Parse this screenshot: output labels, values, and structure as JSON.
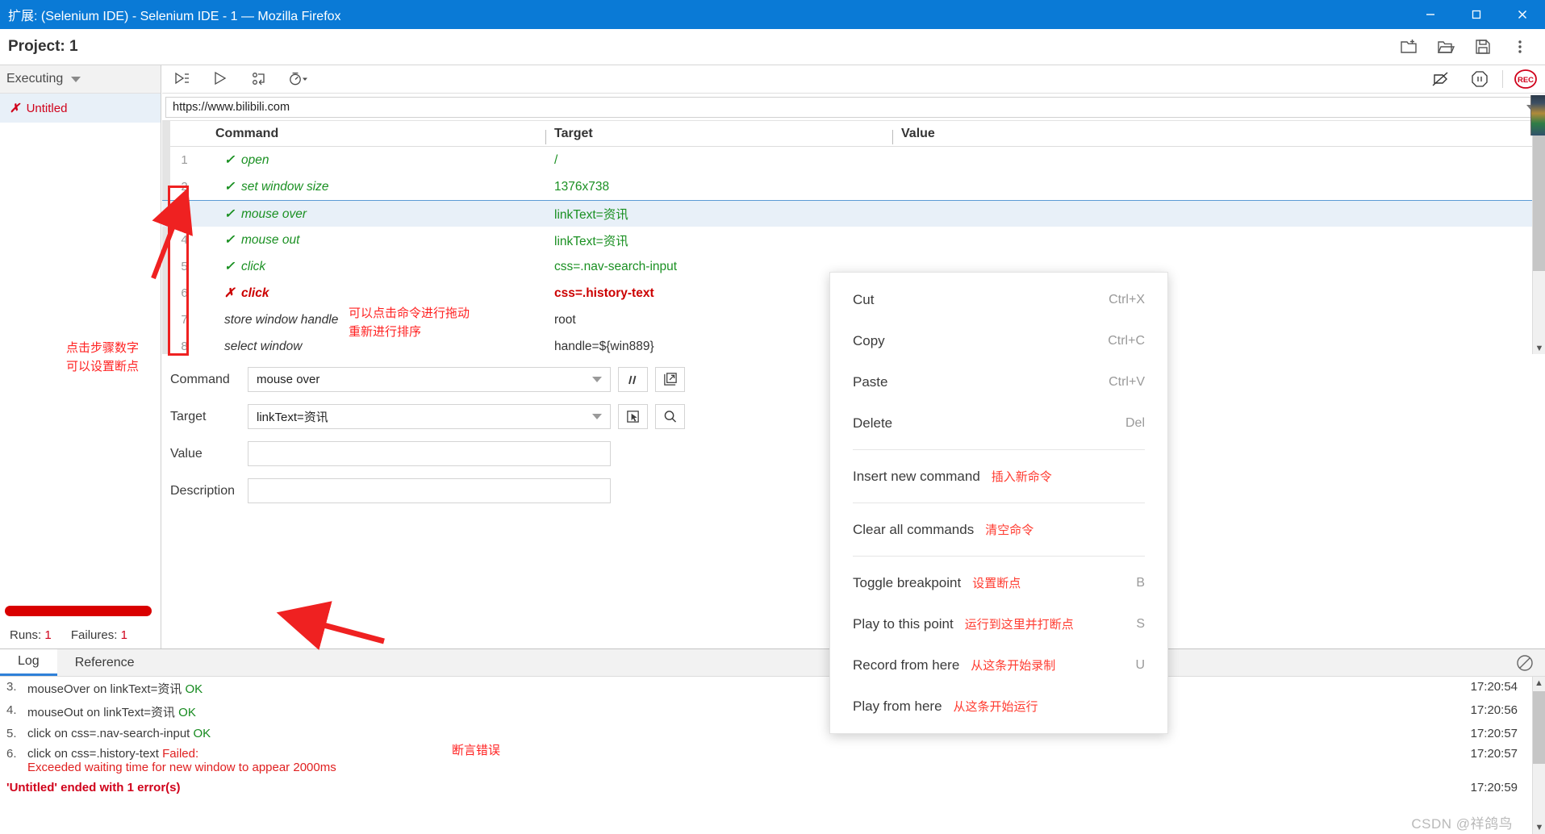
{
  "window": {
    "title": "扩展:  (Selenium IDE) - Selenium IDE - 1 — Mozilla Firefox",
    "minimize_label": "minimize",
    "maximize_label": "maximize",
    "close_label": "close"
  },
  "header": {
    "project_label": "Project:  1",
    "icons": [
      "new-project-icon",
      "open-project-icon",
      "save-project-icon",
      "more-options-icon"
    ]
  },
  "sidebar": {
    "mode_label": "Executing",
    "tests": [
      {
        "status": "✗",
        "name": "Untitled"
      }
    ],
    "annotation": [
      "点击步骤数字",
      "可以设置断点"
    ],
    "runs_label": "Runs:",
    "runs_value": "1",
    "failures_label": "Failures:",
    "failures_value": "1"
  },
  "run_toolbar": {
    "icons": [
      "play-all-tests-icon",
      "play-current-test-icon",
      "step-over-icon",
      "speed-control-icon"
    ],
    "right_icons": [
      "disable-breakpoints-icon",
      "pause-icon",
      "record-icon"
    ],
    "record_label": "REC"
  },
  "url_bar": {
    "value": "https://www.bilibili.com"
  },
  "table": {
    "columns": [
      "Command",
      "Target",
      "Value"
    ],
    "rows": [
      {
        "num": "1",
        "status": "✓",
        "status_kind": "ok",
        "command": "open",
        "target": "/",
        "value": ""
      },
      {
        "num": "2",
        "status": "✓",
        "status_kind": "ok",
        "command": "set window size",
        "target": "1376x738",
        "value": ""
      },
      {
        "num": "3",
        "status": "✓",
        "status_kind": "ok",
        "command": "mouse over",
        "target": "linkText=资讯",
        "value": ""
      },
      {
        "num": "4",
        "status": "✓",
        "status_kind": "ok",
        "command": "mouse out",
        "target": "linkText=资讯",
        "value": ""
      },
      {
        "num": "5",
        "status": "✓",
        "status_kind": "ok",
        "command": "click",
        "target": "css=.nav-search-input",
        "value": ""
      },
      {
        "num": "6",
        "status": "✗",
        "status_kind": "error",
        "command": "click",
        "target": "css=.history-text",
        "value": ""
      },
      {
        "num": "7",
        "status": "",
        "status_kind": "plain",
        "command": "store window handle",
        "target": "root",
        "value": ""
      },
      {
        "num": "8",
        "status": "",
        "status_kind": "plain",
        "command": "select window",
        "target": "handle=${win889}",
        "value": ""
      }
    ],
    "annotation": [
      "可以点击命令进行拖动",
      "重新进行排序"
    ]
  },
  "form": {
    "command_label": "Command",
    "command_value": "mouse over",
    "target_label": "Target",
    "target_value": "linkText=资讯",
    "value_label": "Value",
    "value_value": "",
    "description_label": "Description",
    "description_value": "",
    "buttons": [
      "comment-toggle-icon",
      "open-editor-icon",
      "select-target-icon",
      "find-target-icon"
    ]
  },
  "context_menu": {
    "items": [
      {
        "label": "Cut",
        "cn": "",
        "accel": "Ctrl+X"
      },
      {
        "label": "Copy",
        "cn": "",
        "accel": "Ctrl+C"
      },
      {
        "label": "Paste",
        "cn": "",
        "accel": "Ctrl+V"
      },
      {
        "label": "Delete",
        "cn": "",
        "accel": "Del"
      },
      {
        "sep": true
      },
      {
        "label": "Insert new command",
        "cn": "插入新命令",
        "accel": ""
      },
      {
        "sep": true
      },
      {
        "label": "Clear all commands",
        "cn": "清空命令",
        "accel": ""
      },
      {
        "sep": true
      },
      {
        "label": "Toggle breakpoint",
        "cn": "设置断点",
        "accel": "B"
      },
      {
        "label": "Play to this point",
        "cn": "运行到这里并打断点",
        "accel": "S"
      },
      {
        "label": "Record from here",
        "cn": "从这条开始录制",
        "accel": "U"
      },
      {
        "label": "Play from here",
        "cn": "从这条开始运行",
        "accel": ""
      }
    ]
  },
  "log_panel": {
    "tabs": [
      {
        "label": "Log",
        "active": true
      },
      {
        "label": "Reference",
        "active": false
      }
    ],
    "clear_icon": "clear-log-icon",
    "annotation": "断言错误",
    "entries": [
      {
        "index": "3.",
        "text": "mouseOver on linkText=资讯 ",
        "status": "OK",
        "status_kind": "ok",
        "time": "17:20:54"
      },
      {
        "index": "4.",
        "text": "mouseOut on linkText=资讯 ",
        "status": "OK",
        "status_kind": "ok",
        "time": "17:20:56"
      },
      {
        "index": "5.",
        "text": "click on css=.nav-search-input ",
        "status": "OK",
        "status_kind": "ok",
        "time": "17:20:57"
      },
      {
        "index": "6.",
        "text": "click on css=.history-text ",
        "status": "Failed:",
        "status_kind": "error",
        "time": "17:20:57",
        "detail": "Exceeded waiting time for new window to appear 2000ms"
      }
    ],
    "final": "'Untitled' ended with 1 error(s)",
    "final_time": "17:20:59"
  },
  "watermark": "CSDN @祥鸽鸟",
  "colors": {
    "titlebar": "#0a7ad6",
    "ok": "#1a9022",
    "error": "#cc0000",
    "annotation": "#ff2222",
    "selection": "#e8f0f8",
    "accent": "#2f80d8"
  }
}
